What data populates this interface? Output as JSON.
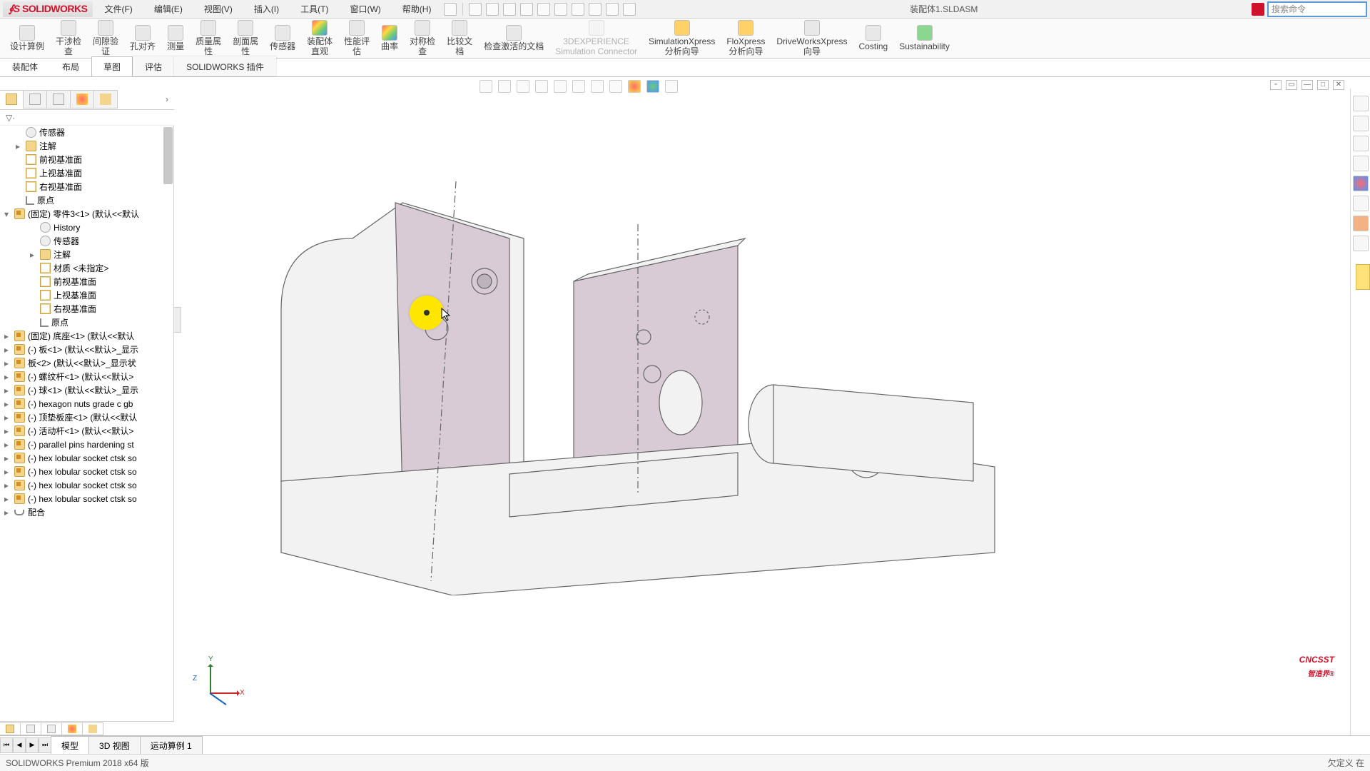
{
  "app": {
    "name": "SOLIDWORKS",
    "document": "装配体1.SLDASM",
    "search_placeholder": "搜索命令"
  },
  "menus": [
    "文件(F)",
    "编辑(E)",
    "视图(V)",
    "插入(I)",
    "工具(T)",
    "窗口(W)",
    "帮助(H)"
  ],
  "ribbon": [
    {
      "id": "design-study",
      "label": "设计算例"
    },
    {
      "id": "interference",
      "label": "干涉检\n查"
    },
    {
      "id": "clearance",
      "label": "间隙验\n证"
    },
    {
      "id": "hole-align",
      "label": "孔对齐"
    },
    {
      "id": "measure",
      "label": "测量"
    },
    {
      "id": "mass-props",
      "label": "质量属\n性"
    },
    {
      "id": "section-props",
      "label": "剖面属\n性"
    },
    {
      "id": "sensor",
      "label": "传感器"
    },
    {
      "id": "asm-vis",
      "label": "装配体\n直观"
    },
    {
      "id": "perf-eval",
      "label": "性能评\n估"
    },
    {
      "id": "curvature",
      "label": "曲率"
    },
    {
      "id": "symmetry",
      "label": "对称检\n查"
    },
    {
      "id": "compare",
      "label": "比较文\n档"
    },
    {
      "id": "check-active",
      "label": "检查激活的文档"
    },
    {
      "id": "3dexp",
      "label": "3DEXPERIENCE\nSimulation Connector",
      "disabled": true
    },
    {
      "id": "simxpress",
      "label": "SimulationXpress\n分析向导"
    },
    {
      "id": "floxpress",
      "label": "FloXpress\n分析向导"
    },
    {
      "id": "drivexpress",
      "label": "DriveWorksXpress\n向导"
    },
    {
      "id": "costing",
      "label": "Costing"
    },
    {
      "id": "sustain",
      "label": "Sustainability"
    }
  ],
  "cm_tabs": [
    {
      "id": "assembly",
      "label": "装配体"
    },
    {
      "id": "layout",
      "label": "布局"
    },
    {
      "id": "sketch",
      "label": "草图",
      "active": true
    },
    {
      "id": "evaluate",
      "label": "评估",
      "shadow": true
    },
    {
      "id": "addins",
      "label": "SOLIDWORKS 插件",
      "shadow": true
    }
  ],
  "tree": [
    {
      "icon": "sensor",
      "label": "传感器",
      "indent": 1
    },
    {
      "icon": "folder",
      "label": "注解",
      "indent": 1,
      "arrow": "▸"
    },
    {
      "icon": "plane",
      "label": "前视基准面",
      "indent": 1
    },
    {
      "icon": "plane",
      "label": "上视基准面",
      "indent": 1
    },
    {
      "icon": "plane",
      "label": "右视基准面",
      "indent": 1
    },
    {
      "icon": "origin",
      "label": "原点",
      "indent": 1
    },
    {
      "icon": "part",
      "label": "(固定) 零件3<1> (默认<<默认",
      "indent": 0,
      "arrow": "▾"
    },
    {
      "icon": "sensor",
      "label": "History",
      "indent": 2
    },
    {
      "icon": "sensor",
      "label": "传感器",
      "indent": 2
    },
    {
      "icon": "folder",
      "label": "注解",
      "indent": 2,
      "arrow": "▸"
    },
    {
      "icon": "plane",
      "label": "材质 <未指定>",
      "indent": 2
    },
    {
      "icon": "plane",
      "label": "前视基准面",
      "indent": 2
    },
    {
      "icon": "plane",
      "label": "上视基准面",
      "indent": 2
    },
    {
      "icon": "plane",
      "label": "右视基准面",
      "indent": 2
    },
    {
      "icon": "origin",
      "label": "原点",
      "indent": 2
    },
    {
      "icon": "part",
      "label": "(固定) 底座<1> (默认<<默认",
      "indent": 0,
      "arrow": "▸"
    },
    {
      "icon": "part",
      "label": "(-) 板<1> (默认<<默认>_显示",
      "indent": 0,
      "arrow": "▸"
    },
    {
      "icon": "part",
      "label": "板<2> (默认<<默认>_显示状",
      "indent": 0,
      "arrow": "▸"
    },
    {
      "icon": "part",
      "label": "(-) 螺纹杆<1> (默认<<默认>",
      "indent": 0,
      "arrow": "▸"
    },
    {
      "icon": "part",
      "label": "(-) 球<1> (默认<<默认>_显示",
      "indent": 0,
      "arrow": "▸"
    },
    {
      "icon": "part",
      "label": "(-) hexagon nuts grade c gb",
      "indent": 0,
      "arrow": "▸"
    },
    {
      "icon": "part",
      "label": "(-) 顶垫板座<1> (默认<<默认",
      "indent": 0,
      "arrow": "▸"
    },
    {
      "icon": "part",
      "label": "(-) 活动杆<1> (默认<<默认>",
      "indent": 0,
      "arrow": "▸"
    },
    {
      "icon": "part",
      "label": "(-) parallel pins hardening st",
      "indent": 0,
      "arrow": "▸"
    },
    {
      "icon": "part",
      "label": "(-) hex lobular socket ctsk so",
      "indent": 0,
      "arrow": "▸"
    },
    {
      "icon": "part",
      "label": "(-) hex lobular socket ctsk so",
      "indent": 0,
      "arrow": "▸"
    },
    {
      "icon": "part",
      "label": "(-) hex lobular socket ctsk so",
      "indent": 0,
      "arrow": "▸"
    },
    {
      "icon": "part",
      "label": "(-) hex lobular socket ctsk so",
      "indent": 0,
      "arrow": "▸"
    },
    {
      "icon": "mate",
      "label": "配合",
      "indent": 0,
      "arrow": "▸"
    }
  ],
  "bottom_tabs": [
    "模型",
    "3D 视图",
    "运动算例 1"
  ],
  "status": {
    "left": "SOLIDWORKS Premium 2018 x64 版",
    "right": "欠定义   在"
  },
  "watermark": "CNCSST"
}
